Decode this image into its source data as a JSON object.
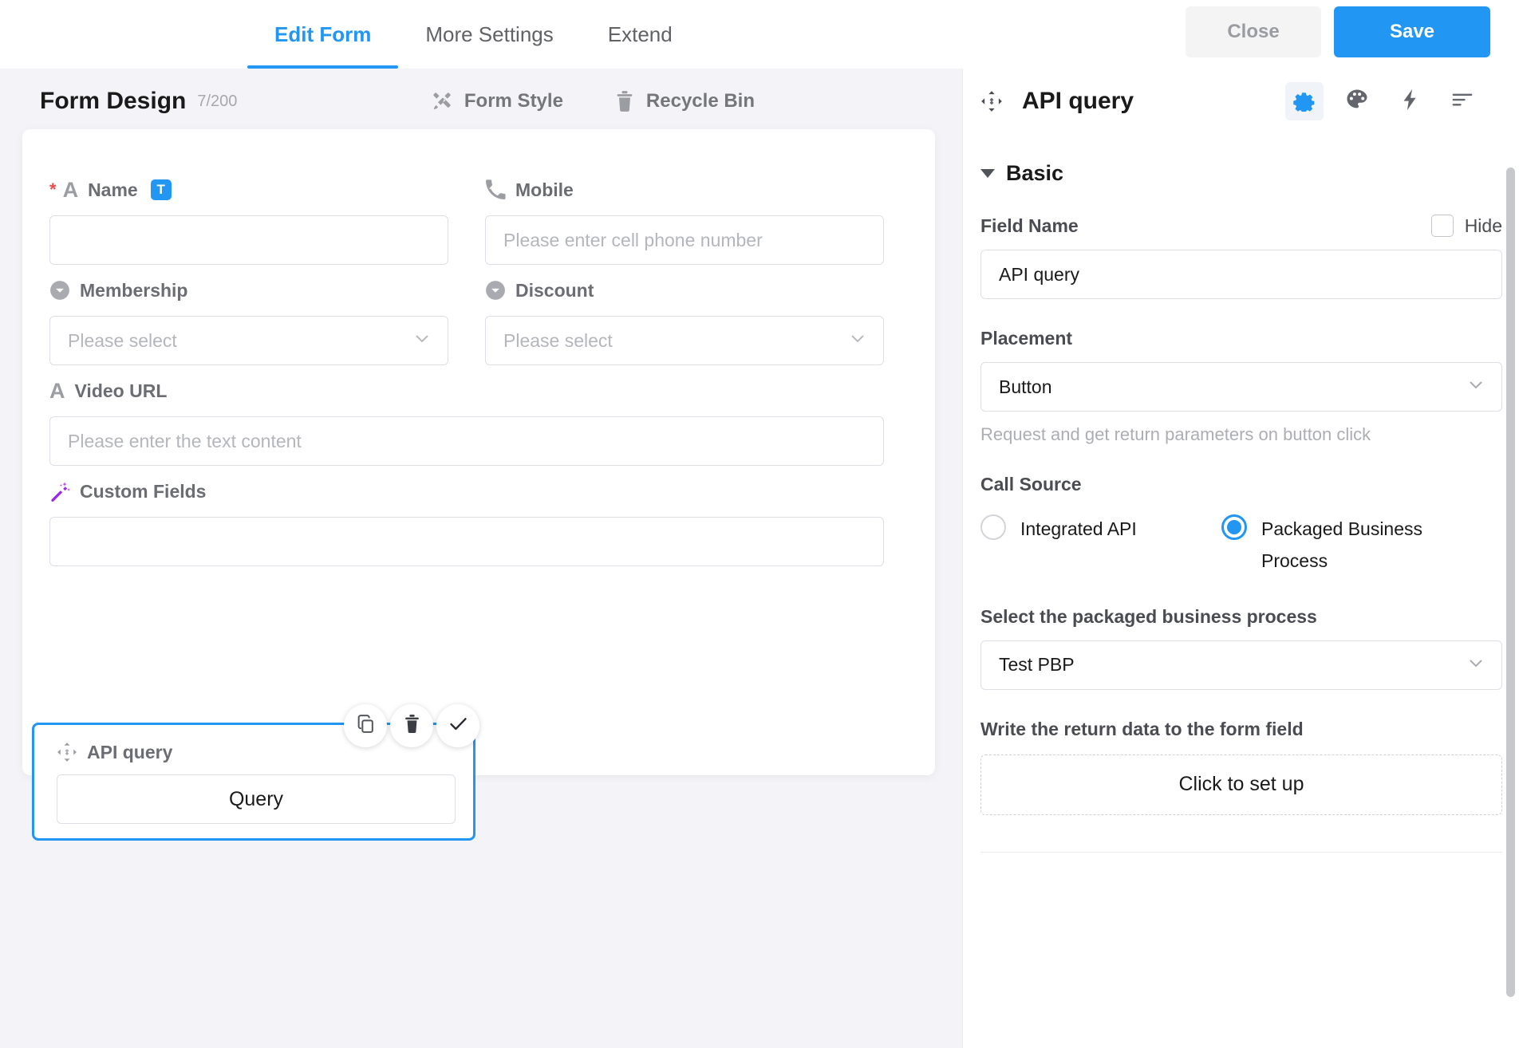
{
  "topbar": {
    "tabs": [
      {
        "label": "Edit Form",
        "active": true
      },
      {
        "label": "More Settings",
        "active": false
      },
      {
        "label": "Extend",
        "active": false
      }
    ],
    "close_label": "Close",
    "save_label": "Save",
    "accent_color": "#2196f3"
  },
  "left_panel": {
    "title": "Form Design",
    "count": "7/200",
    "tools": [
      {
        "label": "Form Style",
        "icon": "brush-icon"
      },
      {
        "label": "Recycle Bin",
        "icon": "trash-icon"
      }
    ],
    "fields": [
      {
        "label": "Name",
        "icon": "text-A-icon",
        "badge": "T",
        "required": true,
        "type": "input",
        "value": "",
        "placeholder": ""
      },
      {
        "label": "Mobile",
        "icon": "phone-icon",
        "required": false,
        "type": "input",
        "value": "",
        "placeholder": "Please enter cell phone number"
      },
      {
        "label": "Membership",
        "icon": "dropdown-circle-icon",
        "required": false,
        "type": "select",
        "value": "Please select"
      },
      {
        "label": "Discount",
        "icon": "dropdown-circle-icon",
        "required": false,
        "type": "select",
        "value": "Please select"
      },
      {
        "label": "Video URL",
        "icon": "text-A-icon",
        "required": false,
        "type": "input",
        "value": "",
        "placeholder": "Please enter the text content"
      },
      {
        "label": "Custom Fields",
        "icon": "magic-wand-icon",
        "required": false,
        "type": "input",
        "value": "",
        "placeholder": ""
      }
    ],
    "selected_field": {
      "label": "API query",
      "icon": "move-arrows-icon",
      "button_label": "Query",
      "actions": [
        {
          "name": "copy-icon",
          "title": "Copy"
        },
        {
          "name": "trash-icon",
          "title": "Delete"
        },
        {
          "name": "check-icon",
          "title": "Confirm"
        }
      ]
    }
  },
  "right_panel": {
    "title": "API query",
    "title_icon": "move-arrows-icon",
    "toolbar_icons": [
      {
        "name": "gear-icon",
        "active": true
      },
      {
        "name": "palette-icon",
        "active": false
      },
      {
        "name": "lightning-icon",
        "active": false
      },
      {
        "name": "align-left-icon",
        "active": false
      }
    ],
    "section_title": "Basic",
    "field_name": {
      "label": "Field Name",
      "hide_label": "Hide",
      "hide_checked": false,
      "value": "API query"
    },
    "placement": {
      "label": "Placement",
      "value": "Button",
      "hint": "Request and get return parameters on button click"
    },
    "call_source": {
      "label": "Call Source",
      "options": [
        {
          "label": "Integrated API",
          "selected": false
        },
        {
          "label": "Packaged Business Process",
          "selected": true
        }
      ]
    },
    "packaged_process": {
      "label": "Select the packaged business process",
      "value": "Test PBP"
    },
    "return_data": {
      "label": "Write the return data to the form field",
      "button_label": "Click to set up"
    }
  }
}
